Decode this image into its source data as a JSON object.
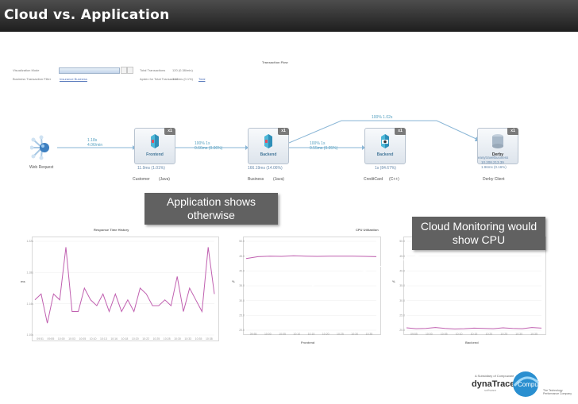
{
  "slide": {
    "title": "Cloud vs. Application"
  },
  "toolbar": {
    "visualization_mode_label": "Visualization Mode",
    "business_transaction_label": "Business Transaction Filter",
    "business_transaction_value": "Insurance Business",
    "total_transactions_label": "Total Transactions",
    "total_transactions_value": "120 (0.38/min)",
    "apdex_label": "Apdex for Total Transaction",
    "apdex_value": "1.15ms (0.1%)",
    "apdex_link": "Total"
  },
  "transaction_flow": {
    "title": "Transaction Flow",
    "web_request": {
      "label": "Web Request",
      "rate": "1.18s",
      "count": "4.06/min"
    },
    "nodes": [
      {
        "name": "Frontend",
        "badge": "x1",
        "stat": "11.9ms (1.01%)",
        "footer_left": "Customer",
        "footer_right": "(Java)"
      },
      {
        "name": "Backend",
        "badge": "x1",
        "stat": "166.19ms (14.06%)",
        "footer_left": "Business",
        "footer_right": "(Java)"
      },
      {
        "name": "Backend",
        "badge": "x1",
        "stat": "1s (84.67%)",
        "footer_left": "CreditCard",
        "footer_right": "(C++)"
      },
      {
        "name": "Derby",
        "badge": "x1",
        "stat_line1": "easytravelbusiness",
        "stat_line2": "10.208.213.39",
        "stat_line3": "1.96ms (0.16%)",
        "footer": "Derby Client"
      }
    ],
    "connections": [
      {
        "line1": "100% 1s",
        "line2": "0.66ms (0.06%)"
      },
      {
        "line1": "100% 1s",
        "line2": "0.55ms (0.05%)"
      },
      {
        "line1": "100% 1.02s",
        "line2": ""
      }
    ]
  },
  "callouts": {
    "application": "Application shows otherwise",
    "cloud": "Cloud Monitoring would show CPU"
  },
  "charts": {
    "response_time_title": "Response Time History",
    "response_y_label": "ms",
    "response_y_ticks": [
      "1.22s",
      "1.18s",
      "1.14s",
      "1.10s"
    ],
    "response_x_ticks": [
      "09:51",
      "09:55",
      "10:00",
      "10:03",
      "10:05",
      "10:10",
      "10:13",
      "10:16",
      "10:18",
      "10:20",
      "10:22",
      "10:25",
      "10:28",
      "10:30",
      "10:33",
      "10:35",
      "10:38"
    ],
    "cpu_title": "CPU Utilization",
    "cpu_y_label": "%",
    "cpu_y_ticks": [
      "50.0",
      "45.0",
      "40.0",
      "35.0",
      "30.0",
      "25.0",
      "20.0"
    ],
    "cpu_x_ticks": [
      "09:55",
      "10:00",
      "10:05",
      "10:10",
      "10:15",
      "10:20",
      "10:25",
      "10:30",
      "10:35"
    ],
    "frontend_label": "Frontend",
    "backend_label": "Backend"
  },
  "chart_data": [
    {
      "type": "line",
      "title": "Response Time History",
      "ylabel": "ms",
      "ylim": [
        1.08,
        1.24
      ],
      "color": "#c060b0",
      "values": [
        1.14,
        1.15,
        1.1,
        1.15,
        1.14,
        1.23,
        1.12,
        1.12,
        1.16,
        1.14,
        1.13,
        1.15,
        1.12,
        1.15,
        1.12,
        1.14,
        1.12,
        1.16,
        1.15,
        1.13,
        1.13,
        1.14,
        1.13,
        1.18,
        1.12,
        1.16,
        1.14,
        1.12,
        1.23,
        1.15
      ]
    },
    {
      "type": "line",
      "title": "CPU Utilization",
      "xlabel": "Frontend",
      "ylabel": "%",
      "ylim": [
        20,
        50
      ],
      "color": "#c060b0",
      "values": [
        44.2,
        44.8,
        45.0,
        44.9,
        45.1,
        45.0,
        44.9,
        45.0,
        45.0,
        45.0,
        44.9,
        44.8
      ]
    },
    {
      "type": "line",
      "title": "CPU Utilization",
      "xlabel": "Backend",
      "ylabel": "%",
      "ylim": [
        20,
        50
      ],
      "color": "#c060b0",
      "values": [
        20.8,
        20.5,
        20.6,
        20.9,
        20.6,
        20.4,
        20.5,
        20.7,
        20.6,
        20.5,
        20.8,
        20.6,
        20.5,
        20.9,
        20.7
      ]
    }
  ],
  "colors": {
    "title_bar": "#2e2e2e",
    "callout_bg": "#616161",
    "node_name": "#447799",
    "line": "#c060b0",
    "connection": "#55a0c0"
  },
  "branding": {
    "subsidiary": "A Subsidiary of Compuware",
    "dynatrace": "dynaTrace",
    "software": "software",
    "compuware": "Compuware",
    "tagline_1": "The Technology",
    "tagline_2": "Performance Company"
  }
}
